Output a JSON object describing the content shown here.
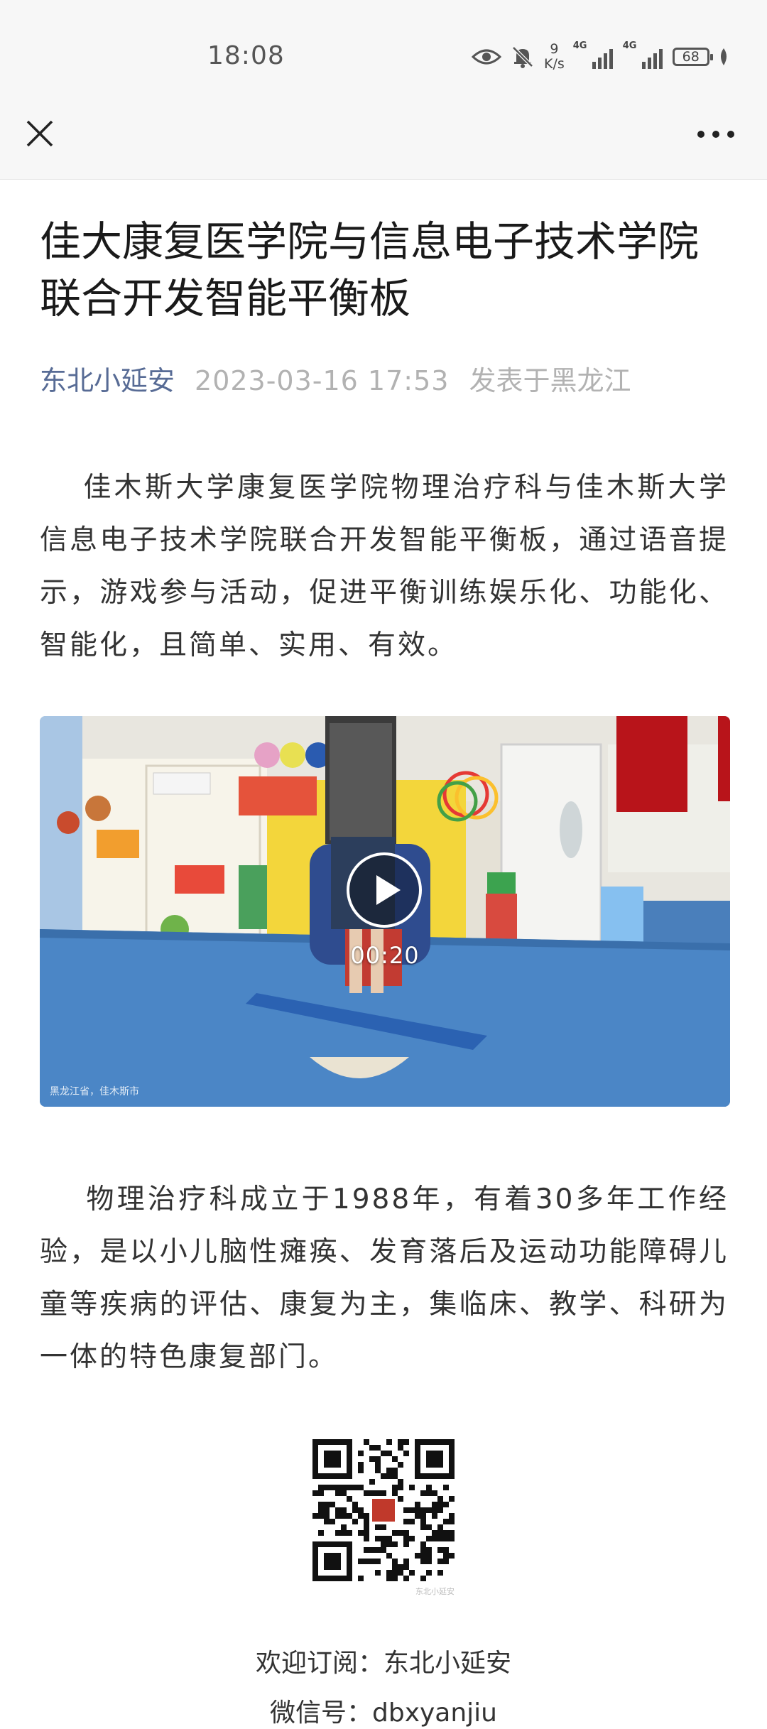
{
  "status_bar": {
    "time": "18:08",
    "net_speed_value": "9",
    "net_speed_unit": "K/s",
    "signal_1_label": "4G",
    "signal_2_label": "4G",
    "battery": "68",
    "icons": [
      "eye-icon",
      "bell-muted-icon",
      "signal-icon",
      "battery-icon",
      "leaf-icon"
    ]
  },
  "nav": {
    "close_icon": "close-icon",
    "more_icon": "more-icon"
  },
  "article": {
    "title": "佳大康复医学院与信息电子技术学院联合开发智能平衡板",
    "author": "东北小延安",
    "date": "2023-03-16 17:53",
    "location": "发表于黑龙江",
    "paragraph_1": "佳木斯大学康复医学院物理治疗科与佳木斯大学信息电子技术学院联合开发智能平衡板，通过语音提示，游戏参与活动，促进平衡训练娱乐化、功能化、智能化，且简单、实用、有效。",
    "video": {
      "duration": "00:20",
      "watermark": "黑龙江省，佳木斯市"
    },
    "paragraph_2": "物理治疗科成立于1988年，有着30多年工作经验，是以小儿脑性瘫痪、发育落后及运动功能障碍儿童等疾病的评估、康复为主，集临床、教学、科研为一体的特色康复部门。",
    "qr_caption": "东北小延安",
    "subscribe": "欢迎订阅：东北小延安",
    "wechat_id": "微信号：dbxyanjiu"
  },
  "colors": {
    "author_link": "#576b95",
    "meta_gray": "#b2b2b2",
    "text": "#333333"
  }
}
